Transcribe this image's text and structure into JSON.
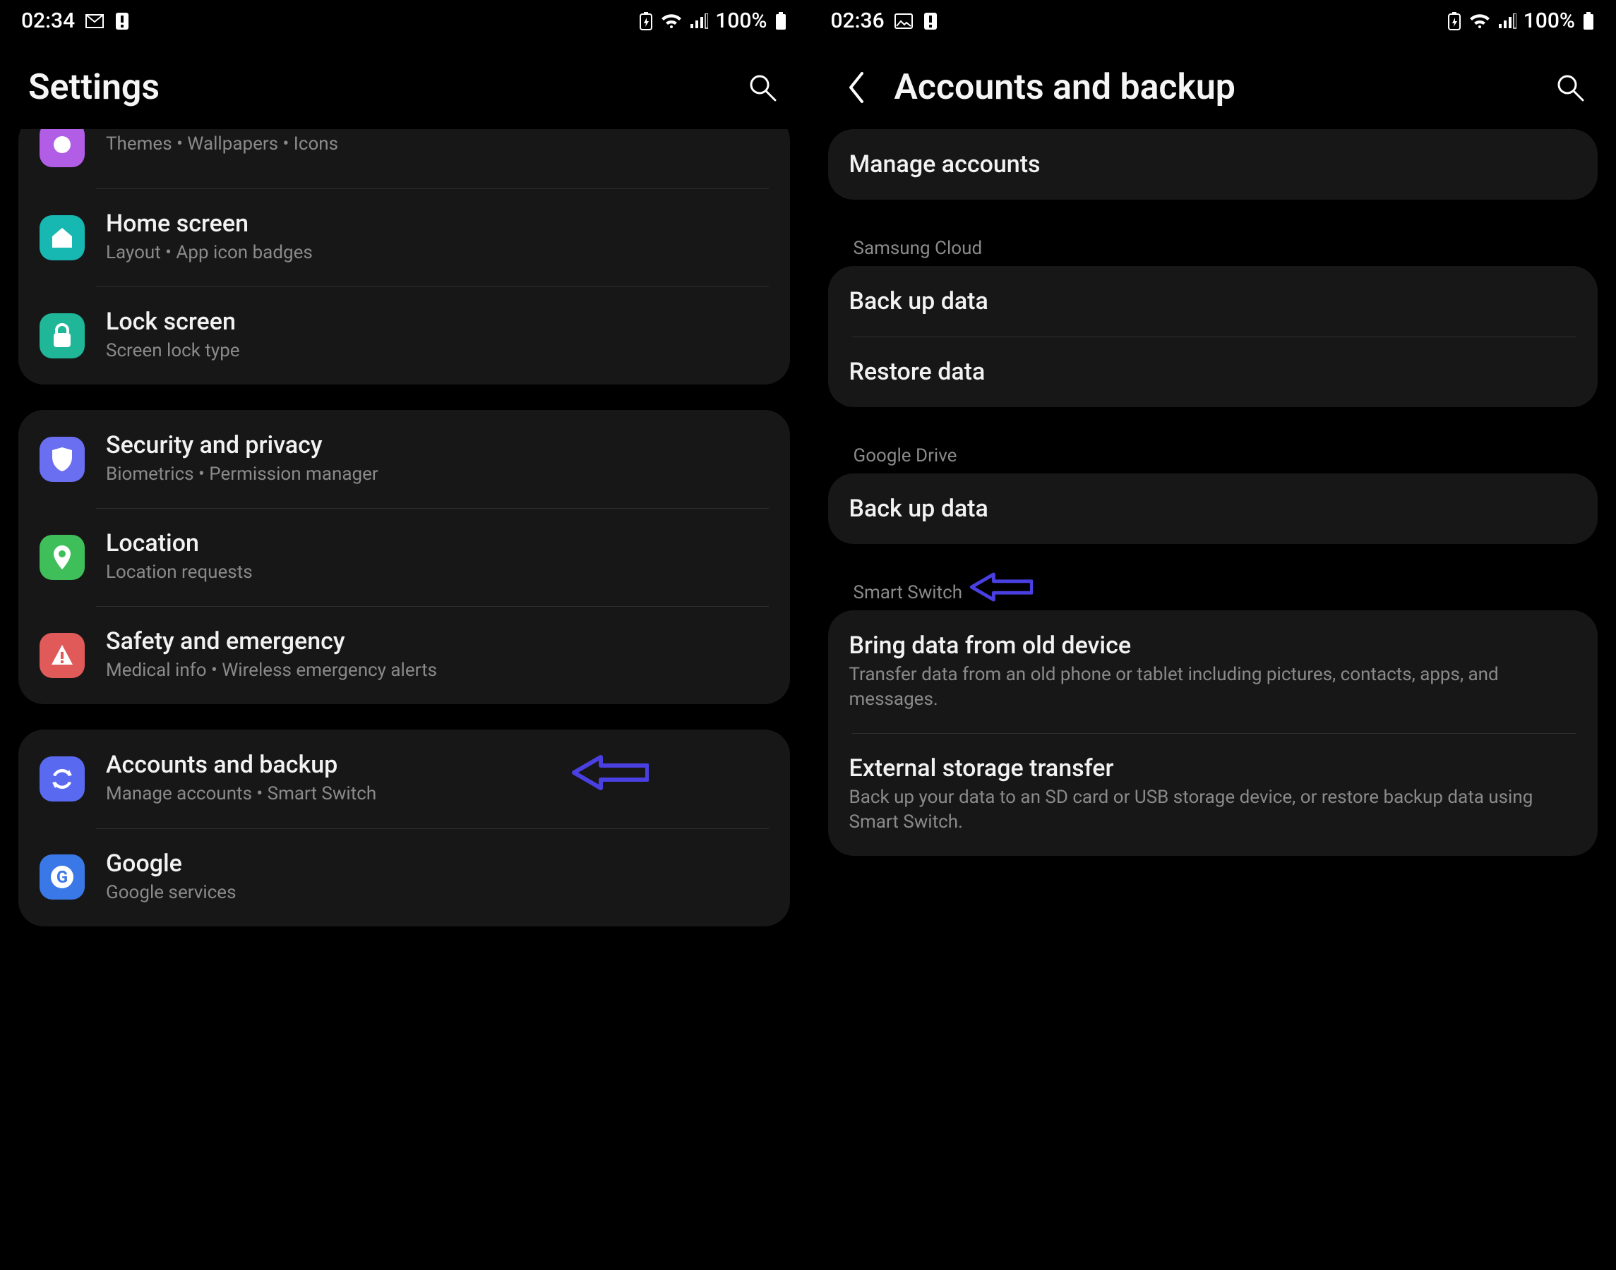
{
  "left": {
    "status": {
      "time": "02:34",
      "battery": "100%"
    },
    "title": "Settings",
    "group_partial": {
      "sub0": "Themes  •  Wallpapers  •  Icons"
    },
    "rows1": [
      {
        "title": "Home screen",
        "sub": "Layout  •  App icon badges"
      },
      {
        "title": "Lock screen",
        "sub": "Screen lock type"
      }
    ],
    "rows2": [
      {
        "title": "Security and privacy",
        "sub": "Biometrics  •  Permission manager"
      },
      {
        "title": "Location",
        "sub": "Location requests"
      },
      {
        "title": "Safety and emergency",
        "sub": "Medical info  •  Wireless emergency alerts"
      }
    ],
    "rows3": [
      {
        "title": "Accounts and backup",
        "sub": "Manage accounts  •  Smart Switch"
      },
      {
        "title": "Google",
        "sub": "Google services"
      }
    ]
  },
  "right": {
    "status": {
      "time": "02:36",
      "battery": "100%"
    },
    "title": "Accounts and backup",
    "manage": "Manage accounts",
    "sec1_header": "Samsung Cloud",
    "sec1": [
      "Back up data",
      "Restore data"
    ],
    "sec2_header": "Google Drive",
    "sec2": [
      "Back up data"
    ],
    "sec3_header": "Smart Switch",
    "sec3": [
      {
        "title": "Bring data from old device",
        "sub": "Transfer data from an old phone or tablet including pictures, contacts, apps, and messages."
      },
      {
        "title": "External storage transfer",
        "sub": "Back up your data to an SD card or USB storage device, or restore backup data using Smart Switch."
      }
    ]
  }
}
